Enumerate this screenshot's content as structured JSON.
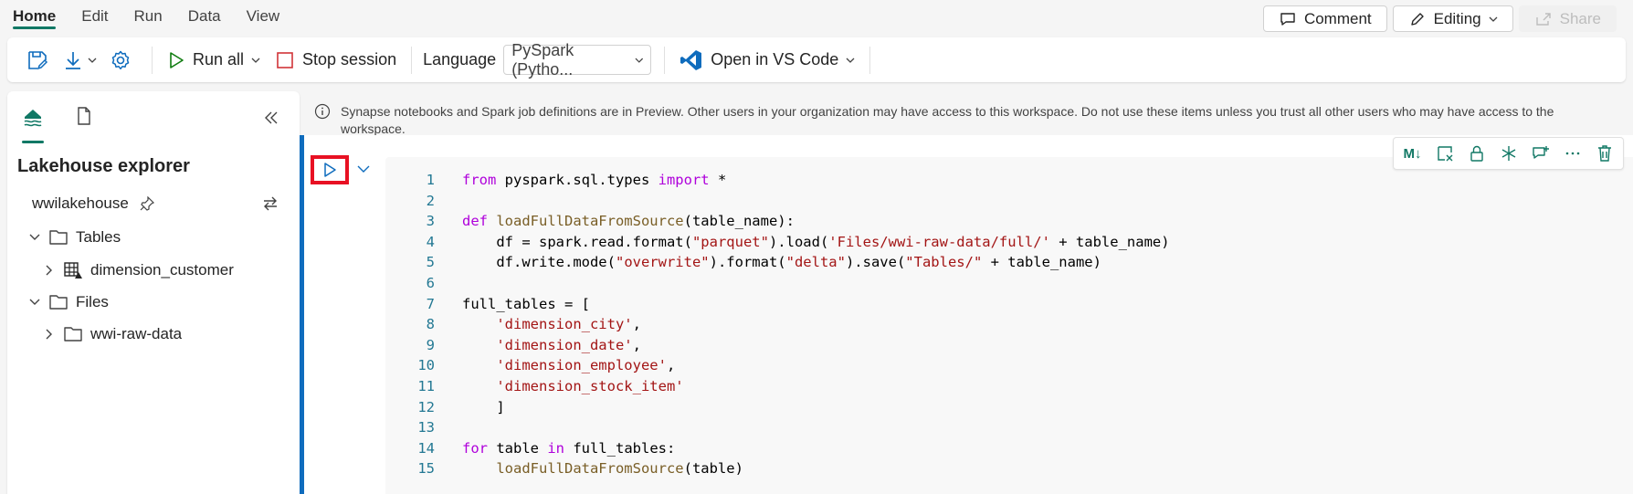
{
  "menu": {
    "items": [
      "Home",
      "Edit",
      "Run",
      "Data",
      "View"
    ]
  },
  "header": {
    "comment_label": "Comment",
    "editing_label": "Editing",
    "share_label": "Share"
  },
  "toolbar": {
    "run_all_label": "Run all",
    "stop_session_label": "Stop session",
    "language_label": "Language",
    "language_value": "PySpark (Pytho...",
    "vscode_label": "Open in VS Code"
  },
  "sidebar": {
    "title": "Lakehouse explorer",
    "lakehouse_name": "wwilakehouse",
    "tree": {
      "tables_label": "Tables",
      "table_item": "dimension_customer",
      "files_label": "Files",
      "file_item": "wwi-raw-data"
    }
  },
  "banner": {
    "text": "Synapse notebooks and Spark job definitions are in Preview. Other users in your organization may have access to this workspace. Do not use these items unless you trust all other users who may have access to the workspace."
  },
  "cell_toolbar": {
    "markdown_label": "M↓"
  },
  "code": {
    "line_numbers": [
      "1",
      "2",
      "3",
      "4",
      "5",
      "6",
      "7",
      "8",
      "9",
      "10",
      "11",
      "12",
      "13",
      "14",
      "15"
    ],
    "l1": {
      "a": "from",
      "b": " pyspark.sql.types ",
      "c": "import",
      "d": " *"
    },
    "l3": {
      "a": "def ",
      "b": "loadFullDataFromSource",
      "c": "(table_name):"
    },
    "l4": {
      "a": "    df = spark.read.format(",
      "b": "\"parquet\"",
      "c": ").load(",
      "d": "'Files/wwi-raw-data/full/'",
      "e": " + table_name)"
    },
    "l5": {
      "a": "    df.write.mode(",
      "b": "\"overwrite\"",
      "c": ").format(",
      "d": "\"delta\"",
      "e": ").save(",
      "f": "\"Tables/\"",
      "g": " + table_name)"
    },
    "l7": {
      "a": "full_tables = ["
    },
    "l8": {
      "a": "    ",
      "b": "'dimension_city'",
      "c": ","
    },
    "l9": {
      "a": "    ",
      "b": "'dimension_date'",
      "c": ","
    },
    "l10": {
      "a": "    ",
      "b": "'dimension_employee'",
      "c": ","
    },
    "l11": {
      "a": "    ",
      "b": "'dimension_stock_item'"
    },
    "l12": {
      "a": "    ]"
    },
    "l14": {
      "a": "for",
      "b": " table ",
      "c": "in",
      "d": " full_tables:"
    },
    "l15": {
      "a": "    ",
      "b": "loadFullDataFromSource",
      "c": "(table)"
    }
  },
  "colors": {
    "accent": "#117865",
    "cell_bar": "#0f6cbd",
    "highlight": "#e81123"
  }
}
